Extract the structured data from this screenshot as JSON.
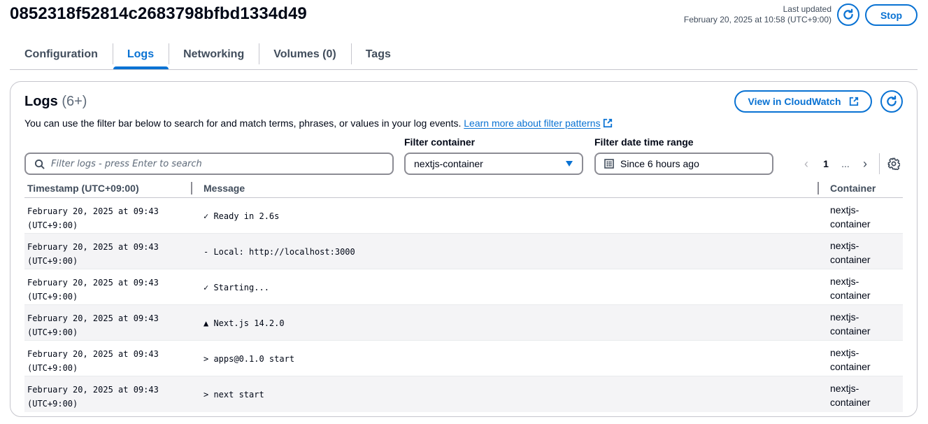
{
  "header": {
    "title": "0852318f52814c2683798bfbd1334d49",
    "last_updated_label": "Last updated",
    "last_updated_value": "February 20, 2025 at 10:58 (UTC+9:00)",
    "refresh_icon": "refresh-icon",
    "stop_label": "Stop"
  },
  "tabs": [
    {
      "label": "Configuration",
      "active": false
    },
    {
      "label": "Logs",
      "active": true
    },
    {
      "label": "Networking",
      "active": false
    },
    {
      "label": "Volumes (0)",
      "active": false
    },
    {
      "label": "Tags",
      "active": false
    }
  ],
  "logs": {
    "title": "Logs",
    "count": "(6+)",
    "description": "You can use the filter bar below to search for and match terms, phrases, or values in your log events.",
    "learn_more_link": "Learn more about filter patterns",
    "view_cloudwatch_label": "View in CloudWatch",
    "search": {
      "placeholder": "Filter logs - press Enter to search",
      "value": ""
    },
    "filter_container": {
      "label": "Filter container",
      "selected": "nextjs-container"
    },
    "filter_date": {
      "label": "Filter date time range",
      "value": "Since 6 hours ago"
    },
    "pagination": {
      "prev": "‹",
      "current_page": "1",
      "ellipsis": "...",
      "next": "›"
    },
    "table": {
      "columns": [
        "Timestamp (UTC+09:00)",
        "Message",
        "Container"
      ],
      "rows": [
        {
          "ts1": "February 20, 2025 at 09:43",
          "ts2": "(UTC+9:00)",
          "message": "✓ Ready in 2.6s",
          "container1": "nextjs-",
          "container2": "container"
        },
        {
          "ts1": "February 20, 2025 at 09:43",
          "ts2": "(UTC+9:00)",
          "message": "- Local: http://localhost:3000",
          "container1": "nextjs-",
          "container2": "container"
        },
        {
          "ts1": "February 20, 2025 at 09:43",
          "ts2": "(UTC+9:00)",
          "message": "✓ Starting...",
          "container1": "nextjs-",
          "container2": "container"
        },
        {
          "ts1": "February 20, 2025 at 09:43",
          "ts2": "(UTC+9:00)",
          "message": "▲ Next.js 14.2.0",
          "container1": "nextjs-",
          "container2": "container"
        },
        {
          "ts1": "February 20, 2025 at 09:43",
          "ts2": "(UTC+9:00)",
          "message": "> apps@0.1.0 start",
          "container1": "nextjs-",
          "container2": "container"
        },
        {
          "ts1": "February 20, 2025 at 09:43",
          "ts2": "(UTC+9:00)",
          "message": "> next start",
          "container1": "nextjs-",
          "container2": "container"
        }
      ]
    }
  },
  "colors": {
    "accent": "#0972d3",
    "text": "#000716",
    "muted": "#414d5c",
    "border": "#c6c6cd",
    "row_alt": "#f4f4f6"
  }
}
